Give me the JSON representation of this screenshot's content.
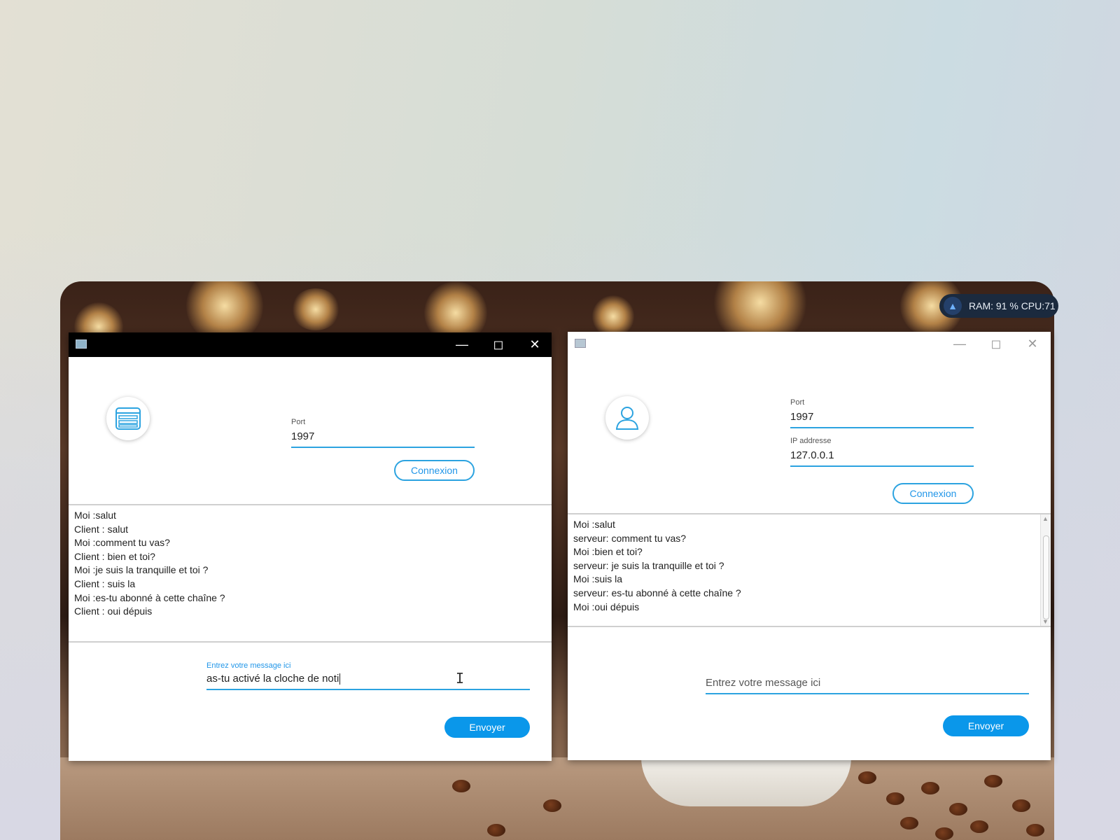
{
  "system_monitor": {
    "text": "RAM: 91 %  CPU:71"
  },
  "server_window": {
    "icon": "server-icon",
    "port": {
      "label": "Port",
      "value": "1997"
    },
    "connect_label": "Connexion",
    "messages": [
      "Moi :salut",
      "Client : salut",
      "Moi :comment tu vas?",
      "Client : bien et toi?",
      "Moi :je suis la tranquille et toi ?",
      "Client : suis la",
      "Moi :es-tu abonné à cette chaîne ?",
      "Client : oui dépuis"
    ],
    "message_field": {
      "label": "Entrez votre message ici",
      "value": "as-tu activé la cloche de noti"
    },
    "send_label": "Envoyer"
  },
  "client_window": {
    "icon": "user-icon",
    "port": {
      "label": "Port",
      "value": "1997"
    },
    "ip": {
      "label": "IP addresse",
      "value": "127.0.0.1"
    },
    "connect_label": "Connexion",
    "messages": [
      "Moi :salut",
      "serveur: comment tu vas?",
      "Moi :bien et toi?",
      "serveur: je suis la tranquille et toi ?",
      "Moi :suis la",
      "serveur: es-tu abonné à cette chaîne ?",
      "Moi :oui dépuis"
    ],
    "message_field": {
      "placeholder": "Entrez votre message ici",
      "value": ""
    },
    "send_label": "Envoyer"
  },
  "colors": {
    "accent": "#0a97ea",
    "underline": "#2ca3e0"
  }
}
